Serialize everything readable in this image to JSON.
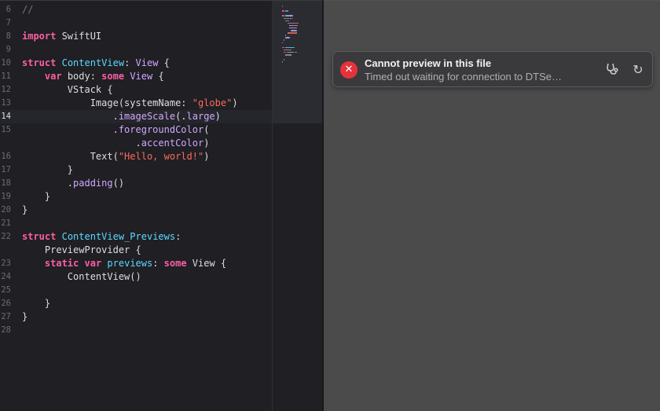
{
  "editor": {
    "current_line": "14",
    "lines": [
      {
        "n": "6",
        "segs": [
          {
            "t": "//",
            "c": "cm"
          }
        ]
      },
      {
        "n": "7",
        "segs": []
      },
      {
        "n": "8",
        "segs": [
          {
            "t": "import",
            "c": "kw"
          },
          {
            "t": " SwiftUI",
            "c": ""
          }
        ]
      },
      {
        "n": "9",
        "segs": []
      },
      {
        "n": "10",
        "segs": [
          {
            "t": "struct",
            "c": "kw"
          },
          {
            "t": " ",
            "c": ""
          },
          {
            "t": "ContentView",
            "c": "ty"
          },
          {
            "t": ": ",
            "c": ""
          },
          {
            "t": "View",
            "c": "pl"
          },
          {
            "t": " {",
            "c": ""
          }
        ]
      },
      {
        "n": "11",
        "segs": [
          {
            "t": "    ",
            "c": ""
          },
          {
            "t": "var",
            "c": "kw"
          },
          {
            "t": " body: ",
            "c": ""
          },
          {
            "t": "some",
            "c": "kw"
          },
          {
            "t": " ",
            "c": ""
          },
          {
            "t": "View",
            "c": "pl"
          },
          {
            "t": " {",
            "c": ""
          }
        ]
      },
      {
        "n": "12",
        "segs": [
          {
            "t": "        VStack {",
            "c": ""
          }
        ]
      },
      {
        "n": "13",
        "segs": [
          {
            "t": "            Image(systemName: ",
            "c": ""
          },
          {
            "t": "\"globe\"",
            "c": "st"
          },
          {
            "t": ")",
            "c": ""
          }
        ]
      },
      {
        "n": "14",
        "segs": [
          {
            "t": "                .",
            "c": ""
          },
          {
            "t": "imageScale",
            "c": "pl"
          },
          {
            "t": "(.",
            "c": ""
          },
          {
            "t": "large",
            "c": "pl"
          },
          {
            "t": ")",
            "c": ""
          }
        ]
      },
      {
        "n": "15",
        "segs": [
          {
            "t": "                .",
            "c": ""
          },
          {
            "t": "foregroundColor",
            "c": "pl"
          },
          {
            "t": "(",
            "c": ""
          }
        ]
      },
      {
        "n": "",
        "segs": [
          {
            "t": "                    .",
            "c": ""
          },
          {
            "t": "accentColor",
            "c": "pl"
          },
          {
            "t": ")",
            "c": ""
          }
        ]
      },
      {
        "n": "16",
        "segs": [
          {
            "t": "            Text(",
            "c": ""
          },
          {
            "t": "\"Hello, world!\"",
            "c": "st"
          },
          {
            "t": ")",
            "c": ""
          }
        ]
      },
      {
        "n": "17",
        "segs": [
          {
            "t": "        }",
            "c": ""
          }
        ]
      },
      {
        "n": "18",
        "segs": [
          {
            "t": "        .",
            "c": ""
          },
          {
            "t": "padding",
            "c": "pl"
          },
          {
            "t": "()",
            "c": ""
          }
        ]
      },
      {
        "n": "19",
        "segs": [
          {
            "t": "    }",
            "c": ""
          }
        ]
      },
      {
        "n": "20",
        "segs": [
          {
            "t": "}",
            "c": ""
          }
        ]
      },
      {
        "n": "21",
        "segs": []
      },
      {
        "n": "22",
        "segs": [
          {
            "t": "struct",
            "c": "kw"
          },
          {
            "t": " ",
            "c": ""
          },
          {
            "t": "ContentView_Previews",
            "c": "ty"
          },
          {
            "t": ":",
            "c": ""
          }
        ]
      },
      {
        "n": "",
        "segs": [
          {
            "t": "    PreviewProvider {",
            "c": ""
          }
        ]
      },
      {
        "n": "23",
        "segs": [
          {
            "t": "    ",
            "c": ""
          },
          {
            "t": "static",
            "c": "kw"
          },
          {
            "t": " ",
            "c": ""
          },
          {
            "t": "var",
            "c": "kw"
          },
          {
            "t": " ",
            "c": ""
          },
          {
            "t": "previews",
            "c": "ty"
          },
          {
            "t": ": ",
            "c": ""
          },
          {
            "t": "some",
            "c": "kw"
          },
          {
            "t": " View {",
            "c": ""
          }
        ]
      },
      {
        "n": "24",
        "segs": [
          {
            "t": "        ContentView()",
            "c": ""
          }
        ]
      },
      {
        "n": "25",
        "segs": []
      },
      {
        "n": "26",
        "segs": [
          {
            "t": "    }",
            "c": ""
          }
        ]
      },
      {
        "n": "27",
        "segs": [
          {
            "t": "}",
            "c": ""
          }
        ]
      },
      {
        "n": "28",
        "segs": []
      }
    ]
  },
  "banner": {
    "title": "Cannot preview in this file",
    "subtitle": "Timed out waiting for connection to DTSe…",
    "error_glyph": "✕",
    "error_icon": "xmark-circle-icon",
    "diagnostics_icon": "stethoscope-icon",
    "refresh_icon": "refresh-icon",
    "refresh_glyph": "↻",
    "error_color": "#e5333b"
  },
  "colors": {
    "keyword": "#fc5fa3",
    "type": "#5dd8ff",
    "plain_member": "#d0a8ff",
    "string": "#fc6a5d",
    "comment": "#6c7986",
    "editor_bg": "#1f1f24",
    "canvas_bg": "#4b4b4c"
  }
}
